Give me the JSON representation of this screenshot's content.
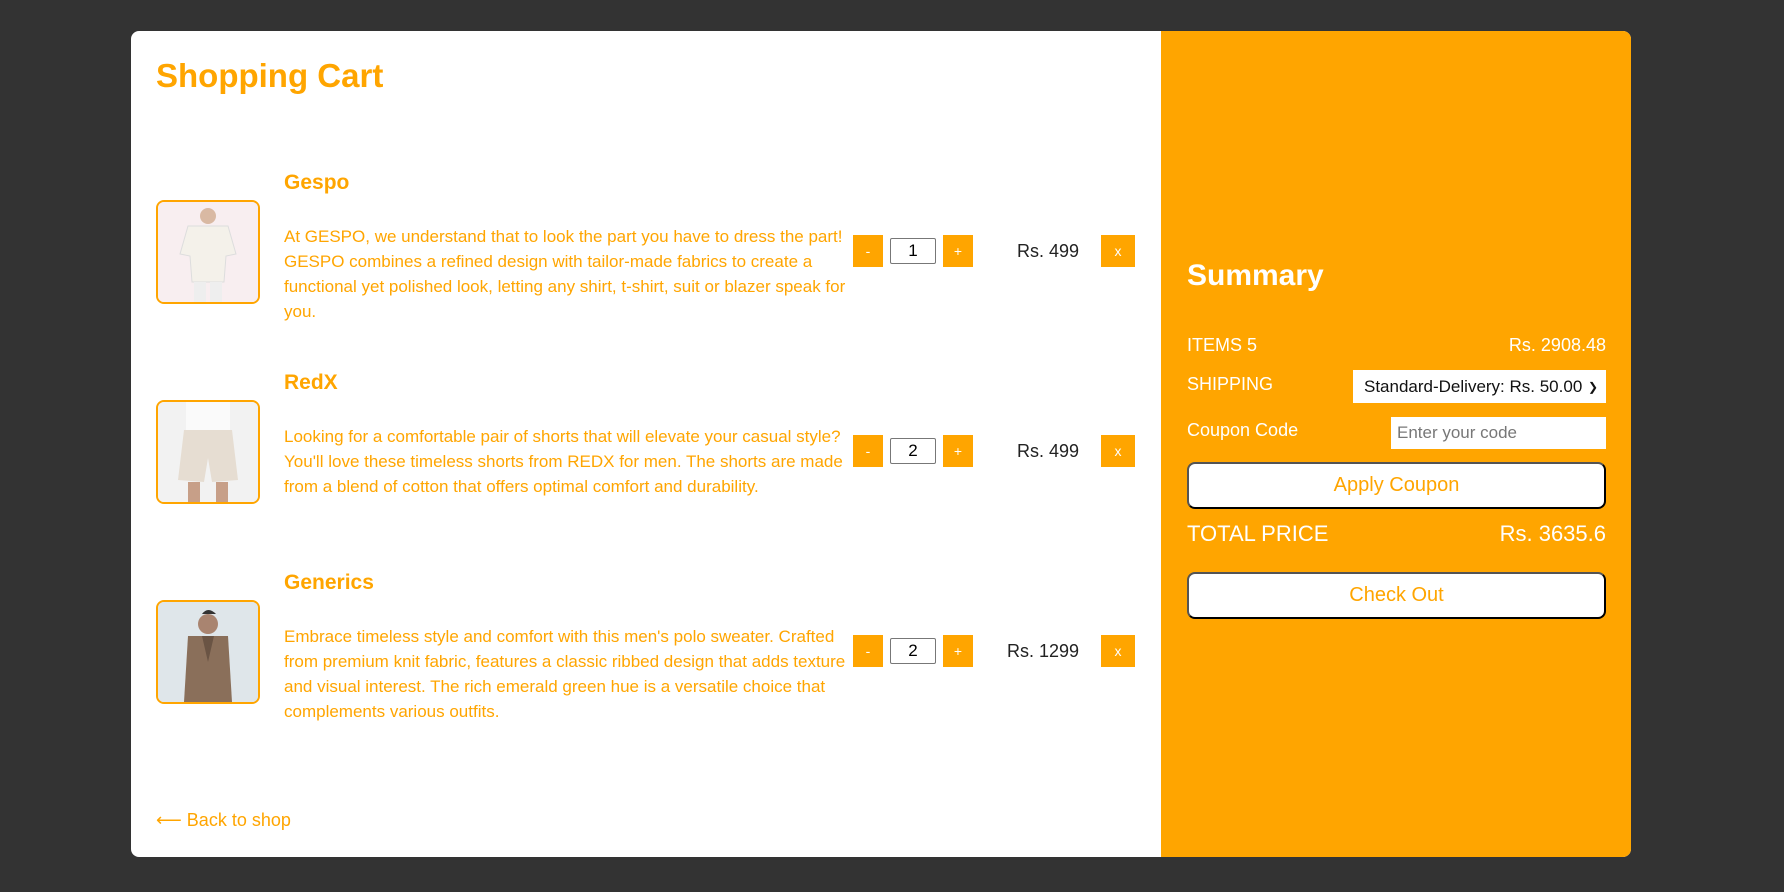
{
  "cart": {
    "title": "Shopping Cart",
    "items": [
      {
        "name": "Gespo",
        "description": "At GESPO, we understand that to look the part you have to dress the part! GESPO combines a refined design with tailor-made fabrics to create a functional yet polished look, letting any shirt, t-shirt, suit or blazer speak for you.",
        "quantity": "1",
        "price": "Rs. 499",
        "minus": "-",
        "plus": "+",
        "remove": "x"
      },
      {
        "name": "RedX",
        "description": "Looking for a comfortable pair of shorts that will elevate your casual style? You'll love these timeless shorts from REDX for men. The shorts are made from a blend of cotton that offers optimal comfort and durability.",
        "quantity": "2",
        "price": "Rs. 499",
        "minus": "-",
        "plus": "+",
        "remove": "x"
      },
      {
        "name": "Generics",
        "description": "Embrace timeless style and comfort with this men's polo sweater. Crafted from premium knit fabric, features a classic ribbed design that adds texture and visual interest. The rich emerald green hue is a versatile choice that complements various outfits.",
        "quantity": "2",
        "price": "Rs. 1299",
        "minus": "-",
        "plus": "+",
        "remove": "x"
      }
    ],
    "back_link": "⟵ Back to shop"
  },
  "summary": {
    "title": "Summary",
    "items_label": "ITEMS 5",
    "items_value": "Rs. 2908.48",
    "shipping_label": "SHIPPING",
    "shipping_selected": "Standard-Delivery: Rs. 50.00",
    "coupon_label": "Coupon Code",
    "coupon_placeholder": "Enter your code",
    "apply_label": "Apply Coupon",
    "total_label": "TOTAL PRICE",
    "total_value": "Rs. 3635.6",
    "checkout_label": "Check Out"
  },
  "colors": {
    "accent": "#FFA500",
    "background": "#333333"
  }
}
